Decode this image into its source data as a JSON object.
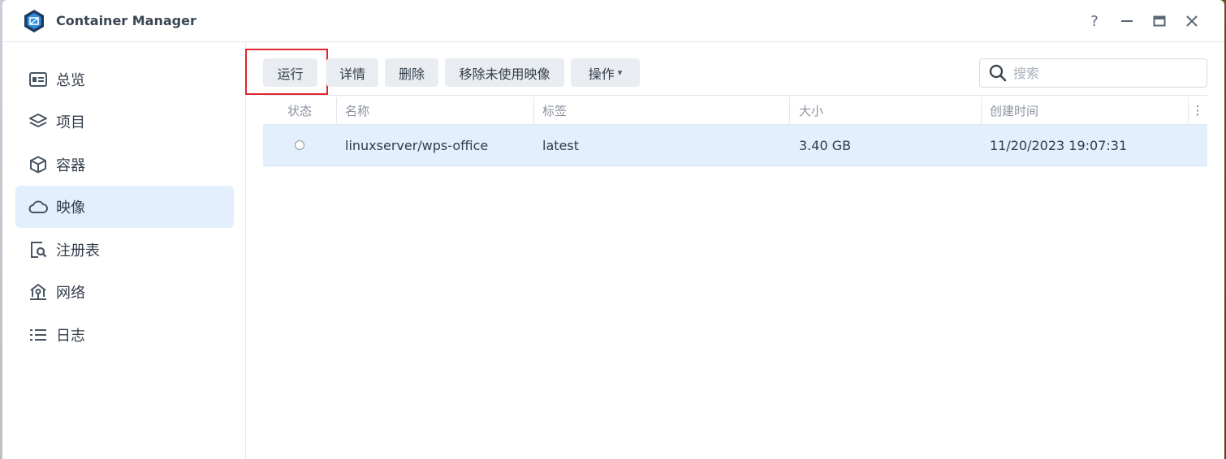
{
  "app": {
    "title": "Container Manager",
    "brand_color": "#1a73c6"
  },
  "window_controls": {
    "help": "?",
    "minimize": "—",
    "maximize": "▭",
    "close": "✕"
  },
  "sidebar": {
    "items": [
      {
        "label": "总览",
        "icon": "overview-icon",
        "active": false
      },
      {
        "label": "项目",
        "icon": "layers-icon",
        "active": false
      },
      {
        "label": "容器",
        "icon": "cube-icon",
        "active": false
      },
      {
        "label": "映像",
        "icon": "cloud-icon",
        "active": true
      },
      {
        "label": "注册表",
        "icon": "registry-search-icon",
        "active": false
      },
      {
        "label": "网络",
        "icon": "network-home-icon",
        "active": false
      },
      {
        "label": "日志",
        "icon": "list-icon",
        "active": false
      }
    ]
  },
  "toolbar": {
    "run": "运行",
    "details": "详情",
    "delete": "删除",
    "remove_unused": "移除未使用映像",
    "actions": "操作",
    "actions_caret": "▾"
  },
  "search": {
    "placeholder": "搜索",
    "value": ""
  },
  "table": {
    "columns": [
      "状态",
      "名称",
      "标签",
      "大小",
      "创建时间"
    ],
    "more": "⋮",
    "rows": [
      {
        "status": "stopped",
        "name": "linuxserver/wps-office",
        "tag": "latest",
        "size": "3.40 GB",
        "created": "11/20/2023 19:07:31",
        "selected": true
      }
    ]
  },
  "colors": {
    "accent": "#e3effc",
    "highlight": "#e0262b"
  }
}
